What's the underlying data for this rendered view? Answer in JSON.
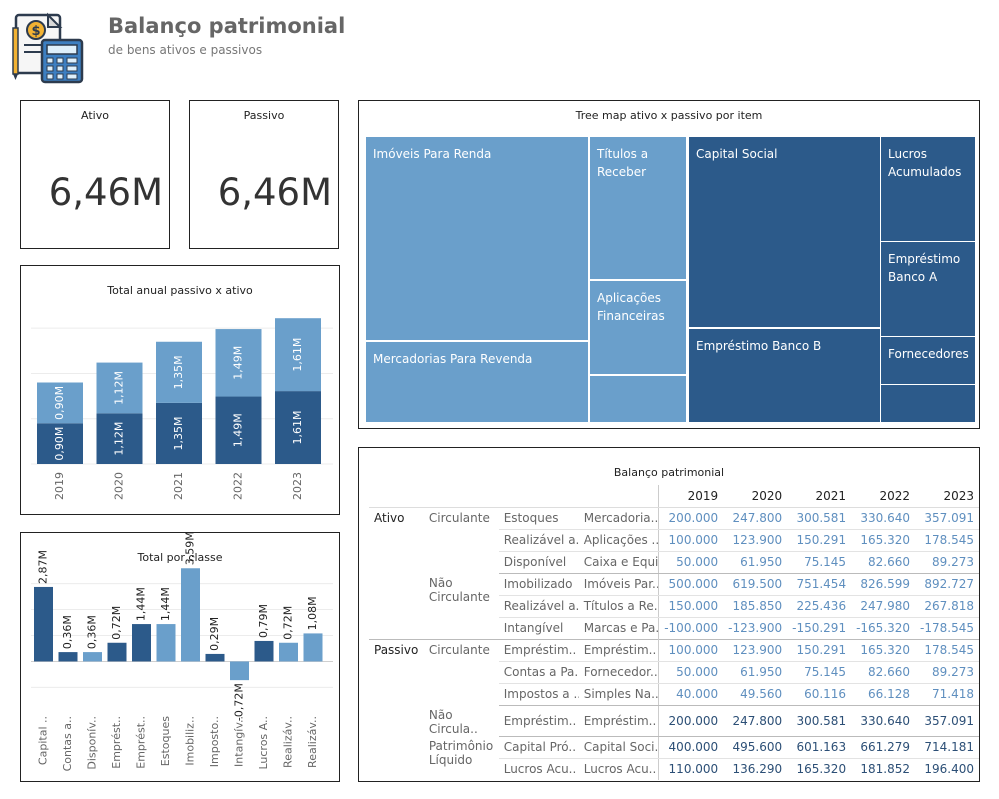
{
  "header": {
    "title": "Balanço patrimonial",
    "subtitle": "de bens ativos e passivos"
  },
  "kpis": [
    {
      "label": "Ativo",
      "value": "6,46M"
    },
    {
      "label": "Passivo",
      "value": "6,46M"
    }
  ],
  "colors": {
    "ativo": "#6a9fcb",
    "passivo": "#2c5a8a"
  },
  "treemap": {
    "title": "Tree map ativo x passivo por item",
    "tiles": [
      {
        "label": "Imóveis Para Renda",
        "group": "ativo"
      },
      {
        "label": "Títulos a Receber",
        "group": "ativo"
      },
      {
        "label": "Mercadorias Para Revenda",
        "group": "ativo"
      },
      {
        "label": "Aplicações Financeiras",
        "group": "ativo"
      },
      {
        "label": "",
        "group": "ativo"
      },
      {
        "label": "Capital Social",
        "group": "passivo"
      },
      {
        "label": "Empréstimo Banco B",
        "group": "passivo"
      },
      {
        "label": "Lucros Acumulados",
        "group": "passivo"
      },
      {
        "label": "Empréstimo Banco A",
        "group": "passivo"
      },
      {
        "label": "Fornecedores",
        "group": "passivo"
      },
      {
        "label": "",
        "group": "passivo"
      }
    ]
  },
  "chart_data": [
    {
      "type": "bar",
      "stacked": true,
      "title": "Total anual passivo x ativo",
      "categories": [
        "2019",
        "2020",
        "2021",
        "2022",
        "2023"
      ],
      "series": [
        {
          "values": [
            0.9,
            1.12,
            1.35,
            1.49,
            1.61
          ],
          "labels": [
            "0,90M",
            "1,12M",
            "1,35M",
            "1,49M",
            "1,61M"
          ],
          "color": "#2c5a8a"
        },
        {
          "values": [
            0.9,
            1.12,
            1.35,
            1.49,
            1.61
          ],
          "labels": [
            "0,90M",
            "1,12M",
            "1,35M",
            "1,49M",
            "1,61M"
          ],
          "color": "#6a9fcb"
        }
      ],
      "ylim": [
        0,
        3.6
      ],
      "grid": true
    },
    {
      "type": "bar",
      "title": "Total por classe",
      "categories": [
        "Capital ..",
        "Contas a..",
        "Disponív..",
        "Emprést..",
        "Emprést..",
        "Estoques",
        "Imobiliz..",
        "Imposto..",
        "Intangív..",
        "Lucros A..",
        "Realizáv..",
        "Realizáv.."
      ],
      "values": [
        2.87,
        0.36,
        0.36,
        0.72,
        1.44,
        1.44,
        3.59,
        0.29,
        -0.72,
        0.79,
        0.72,
        1.08
      ],
      "labels": [
        "2,87M",
        "0,36M",
        "0,36M",
        "0,72M",
        "1,44M",
        "1,44M",
        "3,59M",
        "0,29M",
        "-0,72M",
        "0,79M",
        "0,72M",
        "1,08M"
      ],
      "colors": [
        "#2c5a8a",
        "#2c5a8a",
        "#6a9fcb",
        "#2c5a8a",
        "#2c5a8a",
        "#6a9fcb",
        "#6a9fcb",
        "#2c5a8a",
        "#6a9fcb",
        "#2c5a8a",
        "#6a9fcb",
        "#6a9fcb"
      ],
      "ylim": [
        -1.1,
        3.6
      ],
      "grid": true
    }
  ],
  "table": {
    "title": "Balanço patrimonial",
    "years": [
      "2019",
      "2020",
      "2021",
      "2022",
      "2023"
    ],
    "groups": [
      {
        "name": "Ativo",
        "subgroups": [
          {
            "name": "Circulante",
            "rows": [
              {
                "item": "Estoques",
                "detail": "Mercadoria..",
                "values": [
                  "200.000",
                  "247.800",
                  "300.581",
                  "330.640",
                  "357.091"
                ]
              },
              {
                "item": "Realizável a..",
                "detail": "Aplicações ..",
                "values": [
                  "100.000",
                  "123.900",
                  "150.291",
                  "165.320",
                  "178.545"
                ]
              },
              {
                "item": "Disponível",
                "detail": "Caixa e Equi..",
                "values": [
                  "50.000",
                  "61.950",
                  "75.145",
                  "82.660",
                  "89.273"
                ]
              }
            ]
          },
          {
            "name": "Não Circulante",
            "rows": [
              {
                "item": "Imobilizado",
                "detail": "Imóveis Par..",
                "values": [
                  "500.000",
                  "619.500",
                  "751.454",
                  "826.599",
                  "892.727"
                ]
              },
              {
                "item": "Realizável a..",
                "detail": "Títulos a Re..",
                "values": [
                  "150.000",
                  "185.850",
                  "225.436",
                  "247.980",
                  "267.818"
                ]
              },
              {
                "item": "Intangível",
                "detail": "Marcas e Pa..",
                "values": [
                  "-100.000",
                  "-123.900",
                  "-150.291",
                  "-165.320",
                  "-178.545"
                ]
              }
            ]
          }
        ]
      },
      {
        "name": "Passivo",
        "subgroups": [
          {
            "name": "Circulante",
            "rows": [
              {
                "item": "Empréstim..",
                "detail": "Empréstim..",
                "values": [
                  "100.000",
                  "123.900",
                  "150.291",
                  "165.320",
                  "178.545"
                ]
              },
              {
                "item": "Contas a Pa..",
                "detail": "Fornecedor..",
                "values": [
                  "50.000",
                  "61.950",
                  "75.145",
                  "82.660",
                  "89.273"
                ]
              },
              {
                "item": "Impostos a ..",
                "detail": "Simples Na..",
                "values": [
                  "40.000",
                  "49.560",
                  "60.116",
                  "66.128",
                  "71.418"
                ]
              }
            ]
          },
          {
            "name": "Não Circula..",
            "rows": [
              {
                "item": "Empréstim..",
                "detail": "Empréstim..",
                "values": [
                  "200.000",
                  "247.800",
                  "300.581",
                  "330.640",
                  "357.091"
                ]
              }
            ]
          },
          {
            "name": "Patrimônio Líquido",
            "rows": [
              {
                "item": "Capital Pró..",
                "detail": "Capital Soci..",
                "values": [
                  "400.000",
                  "495.600",
                  "601.163",
                  "661.279",
                  "714.181"
                ]
              },
              {
                "item": "Lucros Acu..",
                "detail": "Lucros Acu..",
                "values": [
                  "110.000",
                  "136.290",
                  "165.320",
                  "181.852",
                  "196.400"
                ]
              }
            ]
          }
        ]
      }
    ]
  }
}
